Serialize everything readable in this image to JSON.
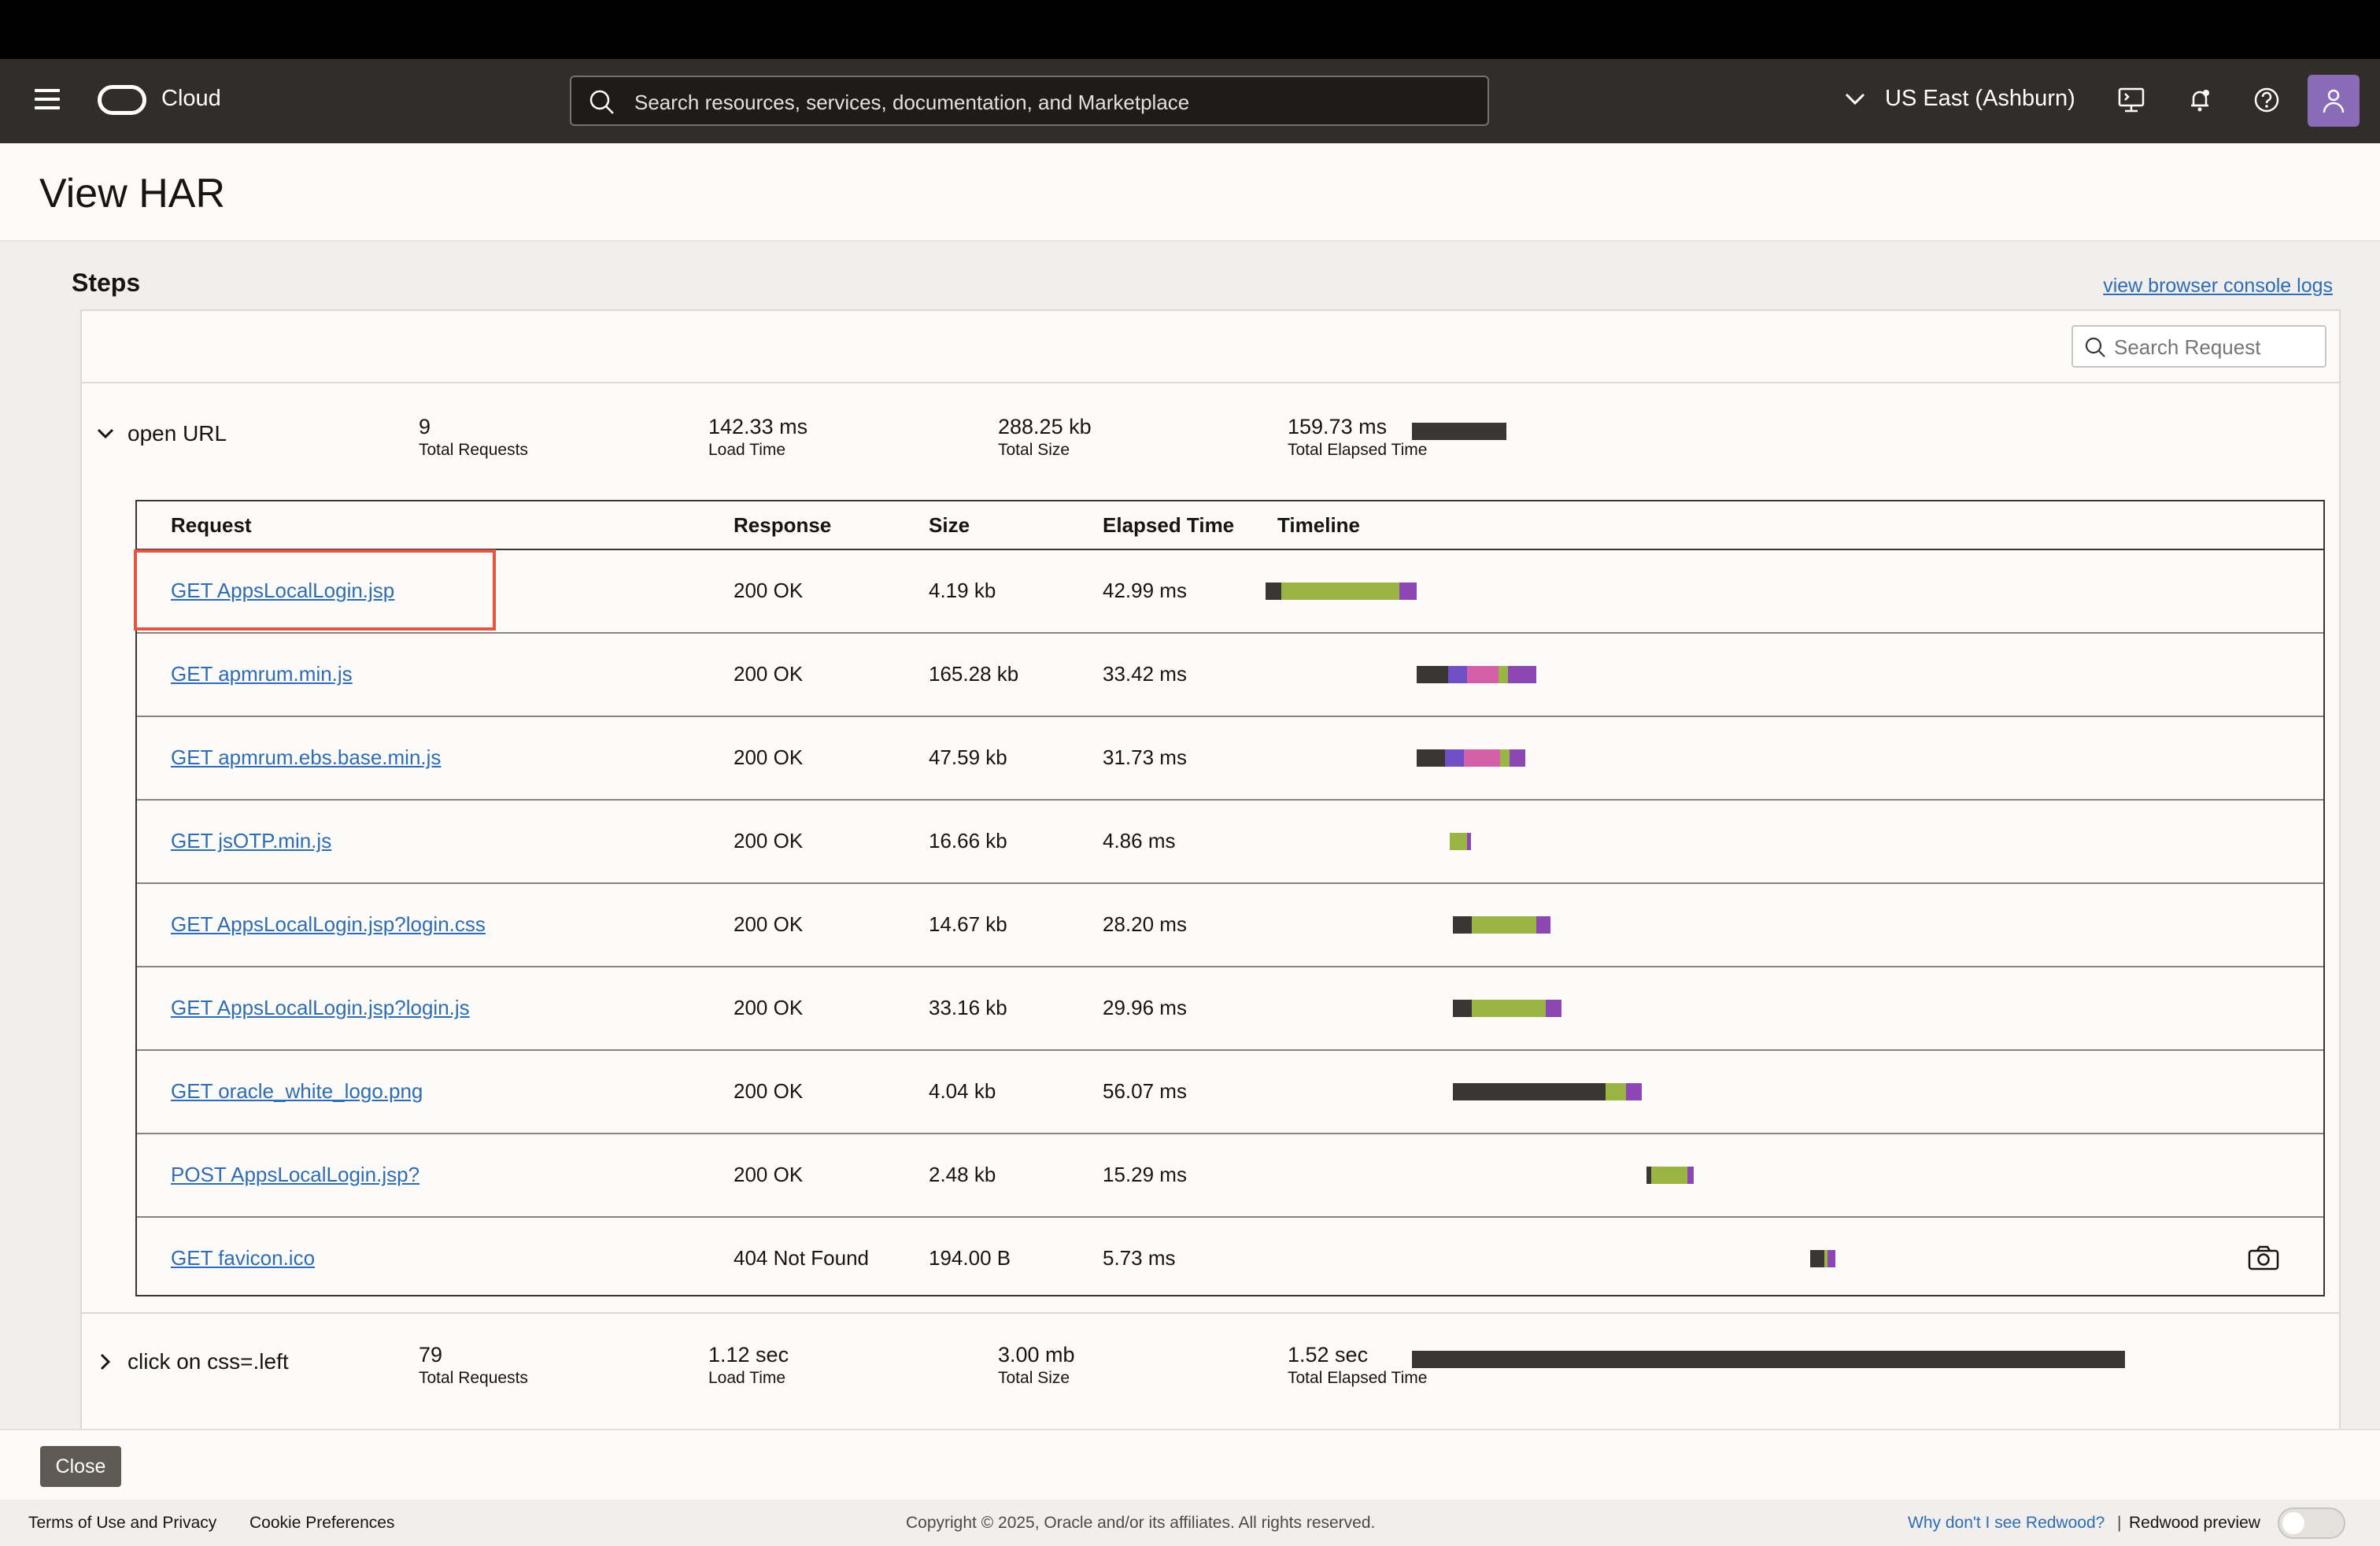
{
  "header": {
    "brand": "Cloud",
    "search_placeholder": "Search resources, services, documentation, and Marketplace",
    "region": "US East (Ashburn)"
  },
  "page_title": "View HAR",
  "steps_label": "Steps",
  "console_link": "view browser console logs",
  "search_request_placeholder": "Search Request",
  "stat_labels": {
    "total_requests": "Total Requests",
    "load_time": "Load Time",
    "total_size": "Total Size",
    "total_elapsed": "Total Elapsed Time"
  },
  "steps": [
    {
      "name": "open URL",
      "expanded": true,
      "total_requests": "9",
      "load_time": "142.33 ms",
      "total_size": "288.25 kb",
      "total_elapsed": "159.73 ms"
    },
    {
      "name": "click on css=.left",
      "expanded": false,
      "total_requests": "79",
      "load_time": "1.12 sec",
      "total_size": "3.00 mb",
      "total_elapsed": "1.52 sec"
    }
  ],
  "table": {
    "columns": [
      "Request",
      "Response",
      "Size",
      "Elapsed Time",
      "Timeline"
    ],
    "rows": [
      {
        "request": "GET  AppsLocalLogin.jsp",
        "response": "200 OK",
        "size": "4.19 kb",
        "elapsed": "42.99 ms"
      },
      {
        "request": "GET  apmrum.min.js",
        "response": "200 OK",
        "size": "165.28 kb",
        "elapsed": "33.42 ms"
      },
      {
        "request": "GET  apmrum.ebs.base.min.js",
        "response": "200 OK",
        "size": "47.59 kb",
        "elapsed": "31.73 ms"
      },
      {
        "request": "GET  jsOTP.min.js",
        "response": "200 OK",
        "size": "16.66 kb",
        "elapsed": "4.86 ms"
      },
      {
        "request": "GET  AppsLocalLogin.jsp?login.css",
        "response": "200 OK",
        "size": "14.67 kb",
        "elapsed": "28.20 ms"
      },
      {
        "request": "GET  AppsLocalLogin.jsp?login.js",
        "response": "200 OK",
        "size": "33.16 kb",
        "elapsed": "29.96 ms"
      },
      {
        "request": "GET  oracle_white_logo.png",
        "response": "200 OK",
        "size": "4.04 kb",
        "elapsed": "56.07 ms"
      },
      {
        "request": "POST  AppsLocalLogin.jsp?",
        "response": "200 OK",
        "size": "2.48 kb",
        "elapsed": "15.29 ms"
      },
      {
        "request": "GET  favicon.ico",
        "response": "404 Not Found",
        "size": "194.00 B",
        "elapsed": "5.73 ms"
      }
    ]
  },
  "colors": {
    "accent_link": "#2e6db3",
    "highlight": "#e5553f",
    "timeline_wait": "#3a3633",
    "timeline_receive": "#9bb545",
    "timeline_connect": "#6f4fc4",
    "timeline_ssl": "#d35fa8",
    "timeline_other": "#8d47b5"
  },
  "close_button": "Close",
  "footer": {
    "terms": "Terms of Use and Privacy",
    "cookies": "Cookie Preferences",
    "copyright": "Copyright © 2025, Oracle and/or its affiliates. All rights reserved.",
    "redwood_question": "Why don't I see Redwood?",
    "separator": "|",
    "redwood_preview": "Redwood preview"
  }
}
